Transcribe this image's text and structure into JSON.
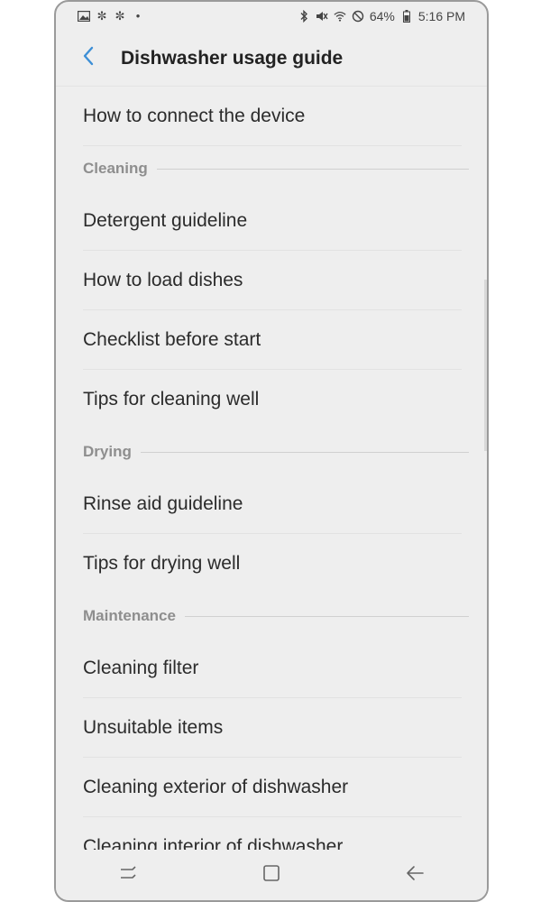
{
  "status_bar": {
    "battery": "64%",
    "time": "5:16 PM",
    "left_icons": [
      "image-icon",
      "fan-icon",
      "fan-icon",
      "dot-icon"
    ],
    "right_icons": [
      "bluetooth-icon",
      "mute-icon",
      "wifi-icon",
      "blocked-icon",
      "battery-icon"
    ]
  },
  "header": {
    "title": "Dishwasher usage guide",
    "back_icon": "chevron-left-icon",
    "accent_color": "#3d8fd6"
  },
  "list": {
    "top_item": "How to connect the device",
    "sections": [
      {
        "title": "Cleaning",
        "items": [
          "Detergent guideline",
          "How to load dishes",
          "Checklist before start",
          "Tips for cleaning well"
        ]
      },
      {
        "title": "Drying",
        "items": [
          "Rinse aid guideline",
          "Tips for drying well"
        ]
      },
      {
        "title": "Maintenance",
        "items": [
          "Cleaning filter",
          "Unsuitable items",
          "Cleaning exterior of dishwasher",
          "Cleaning interior of dishwasher"
        ]
      }
    ]
  },
  "nav_bar": {
    "buttons": [
      "recents-icon",
      "home-icon",
      "back-arrow-icon"
    ]
  }
}
